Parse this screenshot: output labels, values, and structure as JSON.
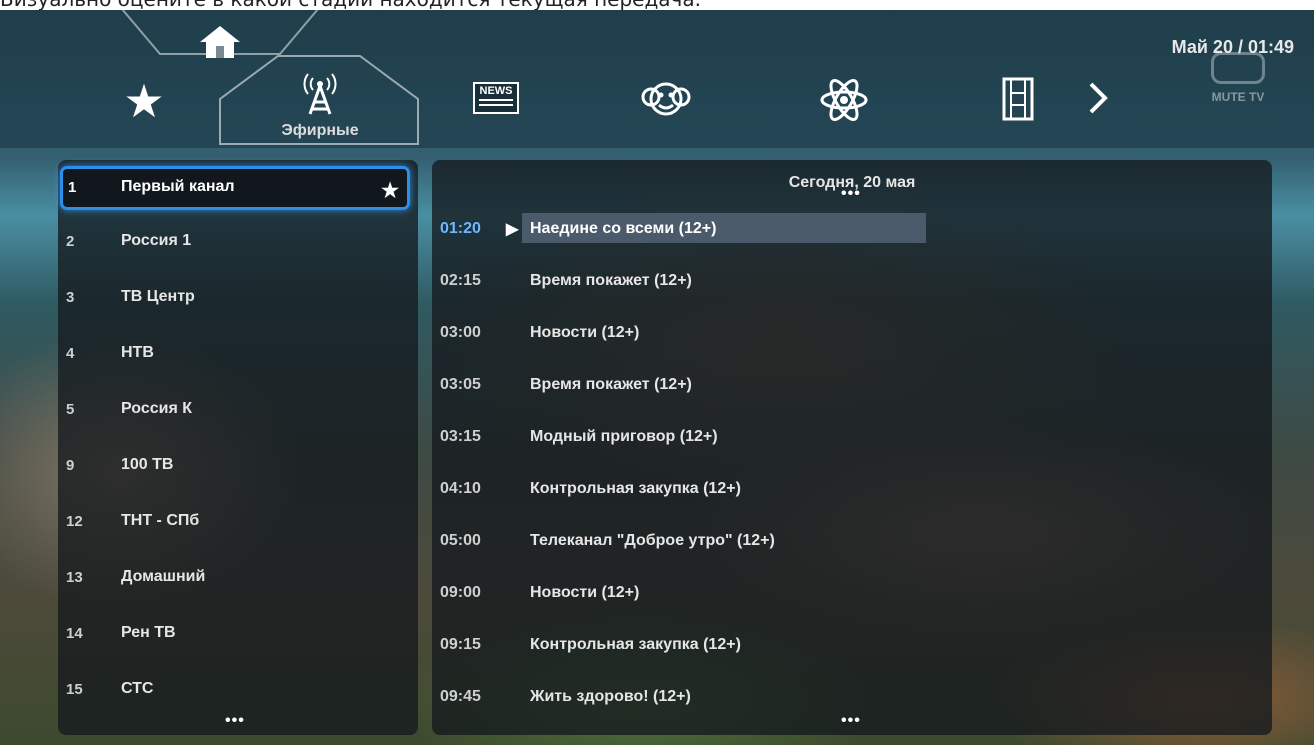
{
  "caption": "Визуально оцените в какой стадии находится текущая передача.",
  "nav": {
    "icons": [
      "home-icon",
      "favorites-star-icon",
      "antenna-icon",
      "news-icon",
      "kids-monkey-icon",
      "science-atom-icon",
      "film-icon",
      "next-chevron-icon"
    ],
    "active_category_label": "Эфирные",
    "news_text": "NEWS"
  },
  "datetime": "Май 20 / 01:49",
  "logo_text": "MUTE TV",
  "channels": {
    "selected": {
      "num": "1",
      "name": "Первый канал"
    },
    "items": [
      {
        "num": "2",
        "name": "Россия 1"
      },
      {
        "num": "3",
        "name": "ТВ Центр"
      },
      {
        "num": "4",
        "name": "НТВ"
      },
      {
        "num": "5",
        "name": "Россия К"
      },
      {
        "num": "9",
        "name": "100 ТВ"
      },
      {
        "num": "12",
        "name": "ТНТ - СПб"
      },
      {
        "num": "13",
        "name": "Домашний"
      },
      {
        "num": "14",
        "name": "Рен ТВ"
      },
      {
        "num": "15",
        "name": "СТС"
      }
    ]
  },
  "epg": {
    "date": "Сегодня, 20 мая",
    "current": {
      "time": "01:20",
      "title": "Наедине со всеми (12+)"
    },
    "programs": [
      {
        "time": "02:15",
        "title": "Время покажет (12+)"
      },
      {
        "time": "03:00",
        "title": "Новости (12+)"
      },
      {
        "time": "03:05",
        "title": "Время покажет (12+)"
      },
      {
        "time": "03:15",
        "title": "Модный приговор (12+)"
      },
      {
        "time": "04:10",
        "title": "Контрольная закупка (12+)"
      },
      {
        "time": "05:00",
        "title": "Телеканал \"Доброе утро\" (12+)"
      },
      {
        "time": "09:00",
        "title": "Новости (12+)"
      },
      {
        "time": "09:15",
        "title": "Контрольная закупка (12+)"
      },
      {
        "time": "09:45",
        "title": "Жить здорово! (12+)"
      }
    ]
  },
  "colors": {
    "accent": "#2a8fe8",
    "current_time": "#6fb6ff",
    "panel_bg": "rgba(20,25,30,0.78)"
  }
}
